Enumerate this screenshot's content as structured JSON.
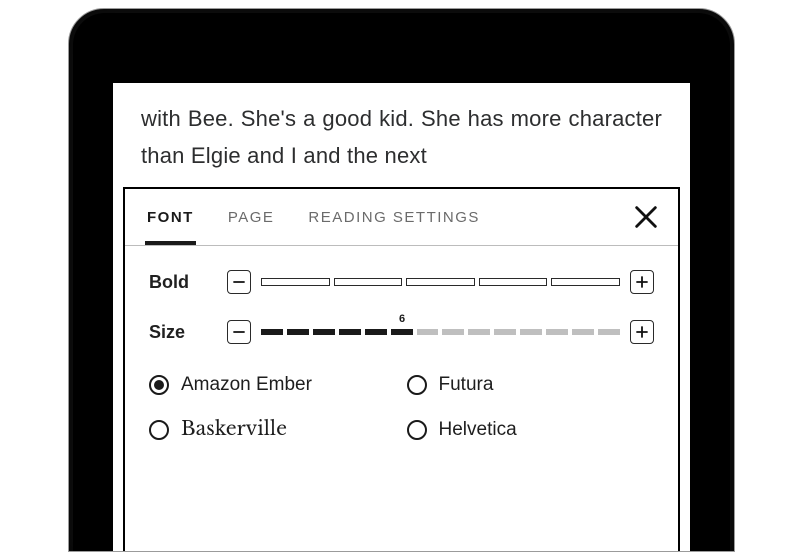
{
  "book": {
    "visible_text": "with Bee. She's a good kid. She has more character than Elgie and I and the next"
  },
  "panel": {
    "tabs": {
      "font": "FONT",
      "page": "PAGE",
      "reading": "READING SETTINGS",
      "active": "font"
    },
    "bold": {
      "label": "Bold",
      "segments": 5,
      "value": 0
    },
    "size": {
      "label": "Size",
      "segments": 14,
      "value": 6,
      "value_label": "6"
    },
    "fonts": {
      "options": [
        {
          "id": "amazon-ember",
          "label": "Amazon Ember",
          "css": "ff-ember",
          "selected": true
        },
        {
          "id": "futura",
          "label": "Futura",
          "css": "ff-futura",
          "selected": false
        },
        {
          "id": "baskerville",
          "label": "Baskerville",
          "css": "ff-basker",
          "selected": false
        },
        {
          "id": "helvetica",
          "label": "Helvetica",
          "css": "ff-helvetica",
          "selected": false
        }
      ]
    }
  }
}
